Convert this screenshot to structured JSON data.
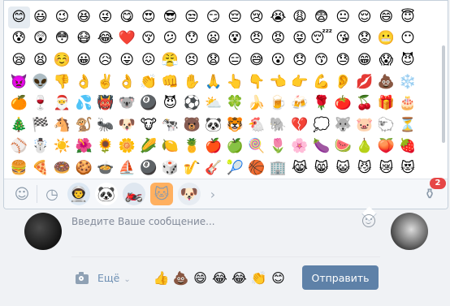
{
  "emoji_grid": [
    "😊",
    "😃",
    "😉",
    "😆",
    "😜",
    "😋",
    "😍",
    "😎",
    "😒",
    "😏",
    "😔",
    "😢",
    "😭",
    "😩",
    "😨",
    "😐",
    "😌",
    "😄",
    "😇",
    "😰",
    "😲",
    "😳",
    "😷",
    "😂",
    "❤️",
    "😚",
    "😕",
    "😯",
    "😦",
    "😵",
    "😠",
    "😡",
    "😝",
    "😴",
    "😘",
    "😟",
    "😬",
    "😶",
    "😪",
    "😫",
    "☺️",
    "😀",
    "😥",
    "😛",
    "😖",
    "😤",
    "😣",
    "😧",
    "😑",
    "😅",
    "😮",
    "😞",
    "😙",
    "😓",
    "😁",
    "😱",
    "😈",
    "👿",
    "👽",
    "👎",
    "👌",
    "✌️",
    "👌",
    "👏",
    "👊",
    "✋",
    "🙏",
    "👆",
    "👇",
    "👈",
    "👉",
    "💪",
    "👂",
    "💋",
    "💩",
    "❄️",
    "🍊",
    "🍷",
    "🎅",
    "💦",
    "👹",
    "🐨",
    "🎱",
    "😈",
    "⚽",
    "⛅",
    "🍀",
    "🍌",
    "🍺",
    "🍻",
    "🌹",
    "🍅",
    "🍒",
    "🎁",
    "🎂",
    "🎄",
    "🏁",
    "🐴",
    "🐒",
    "🐜",
    "🐶",
    "🐮",
    "🐄",
    "🐻",
    "🐼",
    "🐯",
    "🐔",
    "🐘",
    "💔",
    "💭",
    "🐺",
    "🐷",
    "🐑",
    "⏳",
    "⚾",
    "☃️",
    "☀️",
    "🌺",
    "🌻",
    "🌼",
    "🌽",
    "🍋",
    "🍍",
    "🍎",
    "🍏",
    "🍭",
    "🌷",
    "🌸",
    "🍆",
    "🍉",
    "🍐",
    "🍑",
    "🍓",
    "🍔",
    "🍕",
    "🍩",
    "🍪",
    "🍲",
    "⛵",
    "🎱",
    "🎲",
    "🎷",
    "🎸",
    "🎾",
    "🏀",
    "🏢",
    "😹",
    "😸",
    "😺",
    "😼",
    "😿",
    "😻",
    "😽",
    "🙀"
  ],
  "emoji_tabs": {
    "recent_icon": "clock-icon",
    "sticker_packs": [
      "👨‍🚀",
      "🐼",
      "🏍️",
      "🐱",
      "🐶"
    ],
    "next_arrow": "›",
    "store_badge": "2"
  },
  "composer": {
    "placeholder": "Введите Ваше сообщение...",
    "more_label": "Ещё",
    "quick_emojis": [
      "👍",
      "💩",
      "😄",
      "😂",
      "😂",
      "👏",
      "😊"
    ],
    "send_label": "Отправить"
  },
  "colors": {
    "accent": "#5e81a8",
    "link": "#6d8fb3",
    "badge": "#e64646"
  }
}
